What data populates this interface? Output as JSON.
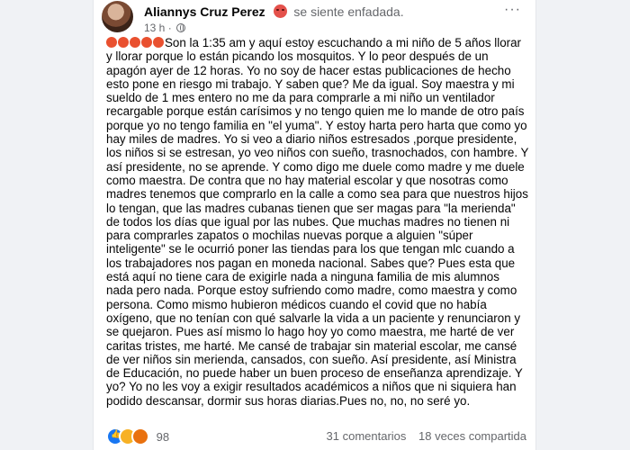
{
  "post": {
    "author": "Aliannys Cruz Perez",
    "feeling": "se siente enfadada.",
    "time": "13 h",
    "more_label": "···",
    "emoji_prefix": 5,
    "text": "Son la 1:35 am y aquí estoy escuchando a mi niño de 5 años llorar y llorar porque lo están picando los mosquitos. Y lo peor después de un apagón ayer de 12 horas. Yo no soy de hacer estas publicaciones de hecho esto pone en riesgo mi trabajo. Y saben que? Me da igual. Soy maestra y mi sueldo de 1 mes entero no me da para comprarle a mi niño un ventilador recargable porque están carísimos y no tengo quien me lo mande de otro país porque yo no tengo familia en \"el yuma\". Y estoy harta pero harta que como yo hay miles de madres. Yo si veo a diario niños estresados ,porque presidente, los niños si se estresan, yo veo niños con sueño, trasnochados, con hambre. Y así presidente, no se aprende. Y como digo me duele como madre y me duele como maestra. De contra que no hay material escolar y que nosotras como madres tenemos que comprarlo en la calle a como sea para que nuestros hijos lo tengan, que las madres cubanas tienen que ser magas para \"la merienda\" de todos los días que igual por las nubes. Que muchas madres no tienen ni para comprarles zapatos o mochilas nuevas porque a alguien \"súper inteligente\" se le ocurrió poner las tiendas para los que tengan mlc cuando a los trabajadores nos pagan en moneda nacional. Sabes que? Pues esta que está aquí no tiene cara de exigirle nada a ninguna familia de mis alumnos nada pero nada. Porque estoy sufriendo como madre, como maestra y como persona. Como mismo hubieron médicos cuando el covid que no había oxígeno, que no tenían con qué salvarle la vida a un paciente y renunciaron y se quejaron. Pues así mismo lo hago hoy yo como maestra, me harté de ver caritas tristes, me harté. Me cansé de trabajar sin material escolar, me cansé de ver niños sin merienda, cansados, con sueño. Así presidente, así Ministra de Educación, no puede haber un buen proceso de enseñanza aprendizaje. Y yo? Yo no les voy a exigir resultados académicos a niños que ni siquiera han podido descansar, dormir sus horas diarias.Pues no, no, no seré yo."
  },
  "footer": {
    "reaction_count": "98",
    "comments": "31 comentarios",
    "shares": "18 veces compartida"
  },
  "icons": [
    "avatar",
    "angry-face-emoji",
    "globe-icon",
    "more-icon",
    "like-reaction",
    "sad-reaction",
    "angry-reaction"
  ],
  "colors": {
    "like": "#1877f2",
    "sad": "#f7b125",
    "angry": "#e9502f",
    "meta_text": "#65676b"
  }
}
